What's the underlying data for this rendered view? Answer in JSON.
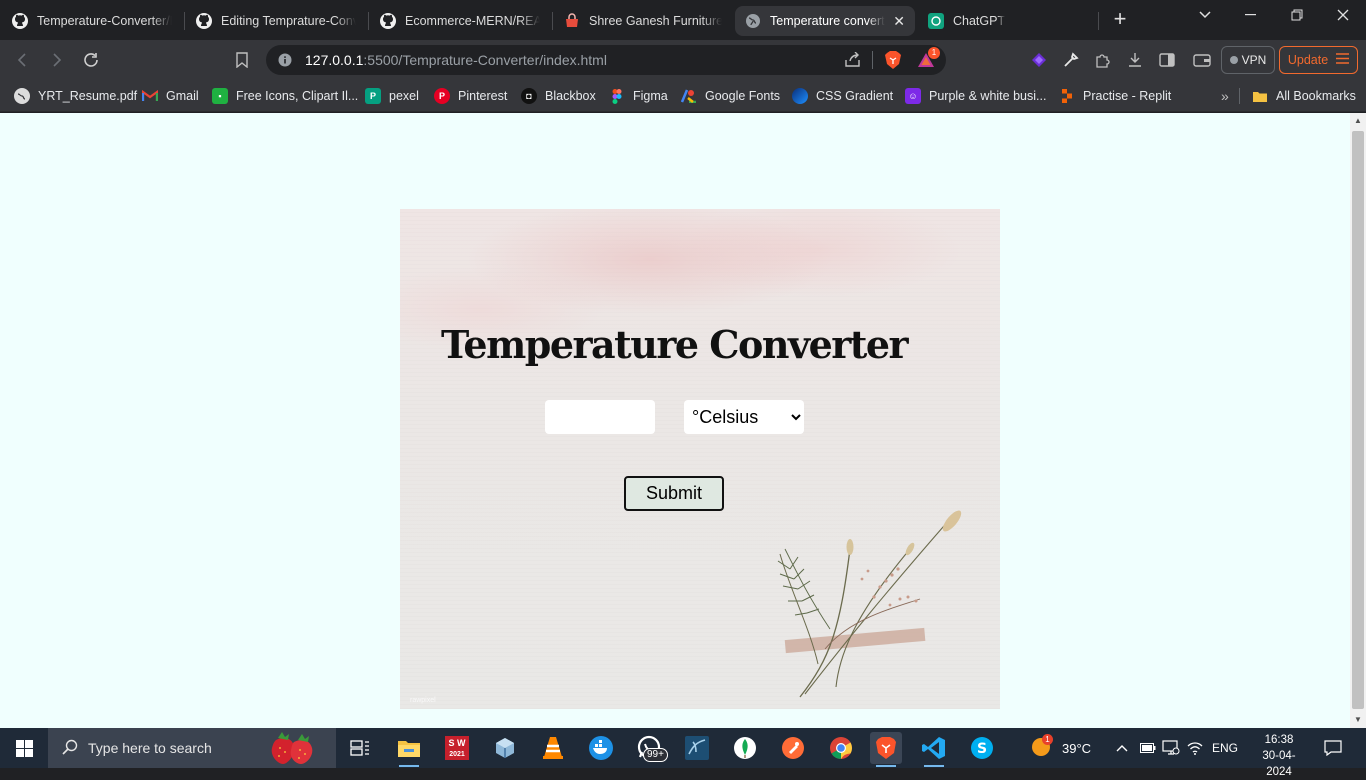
{
  "browser": {
    "tabs": [
      {
        "title": "Temperature-Converter/R",
        "icon": "github-icon",
        "active": false
      },
      {
        "title": "Editing Temprature-Conve",
        "icon": "github-icon",
        "active": false
      },
      {
        "title": "Ecommerce-MERN/READI",
        "icon": "github-icon",
        "active": false
      },
      {
        "title": "Shree Ganesh Furniture",
        "icon": "shop-icon",
        "active": false
      },
      {
        "title": "Temperature converte",
        "icon": "globe-icon",
        "active": true
      },
      {
        "title": "ChatGPT",
        "icon": "chatgpt-icon",
        "active": false
      }
    ],
    "url_host": "127.0.0.1",
    "url_rest": ":5500/Temprature-Converter/index.html",
    "brave_badge": "1",
    "vpn_label": "VPN",
    "update_label": "Update",
    "bookmarks": [
      {
        "label": "YRT_Resume.pdf",
        "icon": "globe-icon",
        "color": "#5f6368"
      },
      {
        "label": "Gmail",
        "icon": "gmail-icon",
        "color": "#ea4335"
      },
      {
        "label": "Free Icons, Clipart Il...",
        "icon": "icons8-icon",
        "color": "#1fb141"
      },
      {
        "label": "pexel",
        "icon": "pexels-icon",
        "color": "#05a081"
      },
      {
        "label": "Pinterest",
        "icon": "pinterest-icon",
        "color": "#e60023"
      },
      {
        "label": "Blackbox",
        "icon": "blackbox-icon",
        "color": "#111111"
      },
      {
        "label": "Figma",
        "icon": "figma-icon",
        "color": "#f24e1e"
      },
      {
        "label": "Google Fonts",
        "icon": "google-fonts-icon",
        "color": "#4285f4"
      },
      {
        "label": "CSS Gradient",
        "icon": "css-gradient-icon",
        "color": "#1e63d6"
      },
      {
        "label": "Purple & white busi...",
        "icon": "canva-icon",
        "color": "#7d2ae8"
      },
      {
        "label": "Practise - Replit",
        "icon": "replit-icon",
        "color": "#f26207"
      }
    ],
    "all_bookmarks_label": "All Bookmarks"
  },
  "page": {
    "heading": "Temperature Converter",
    "input_value": "",
    "unit_options": [
      "°Celsius"
    ],
    "unit_selected": "°Celsius",
    "submit_label": "Submit",
    "watermark": "rawpixel"
  },
  "taskbar": {
    "search_placeholder": "Type here to search",
    "sw_label": "S W",
    "sw_year": "2021",
    "whatsapp_badge": "99+",
    "weather_badge": "1",
    "temperature": "39°C",
    "language": "ENG",
    "time": "16:38",
    "date": "30-04-2024"
  },
  "colors": {
    "page_bg": "#f0fffe",
    "update_accent": "#f26a2e",
    "brave_orange": "#fb542b"
  }
}
